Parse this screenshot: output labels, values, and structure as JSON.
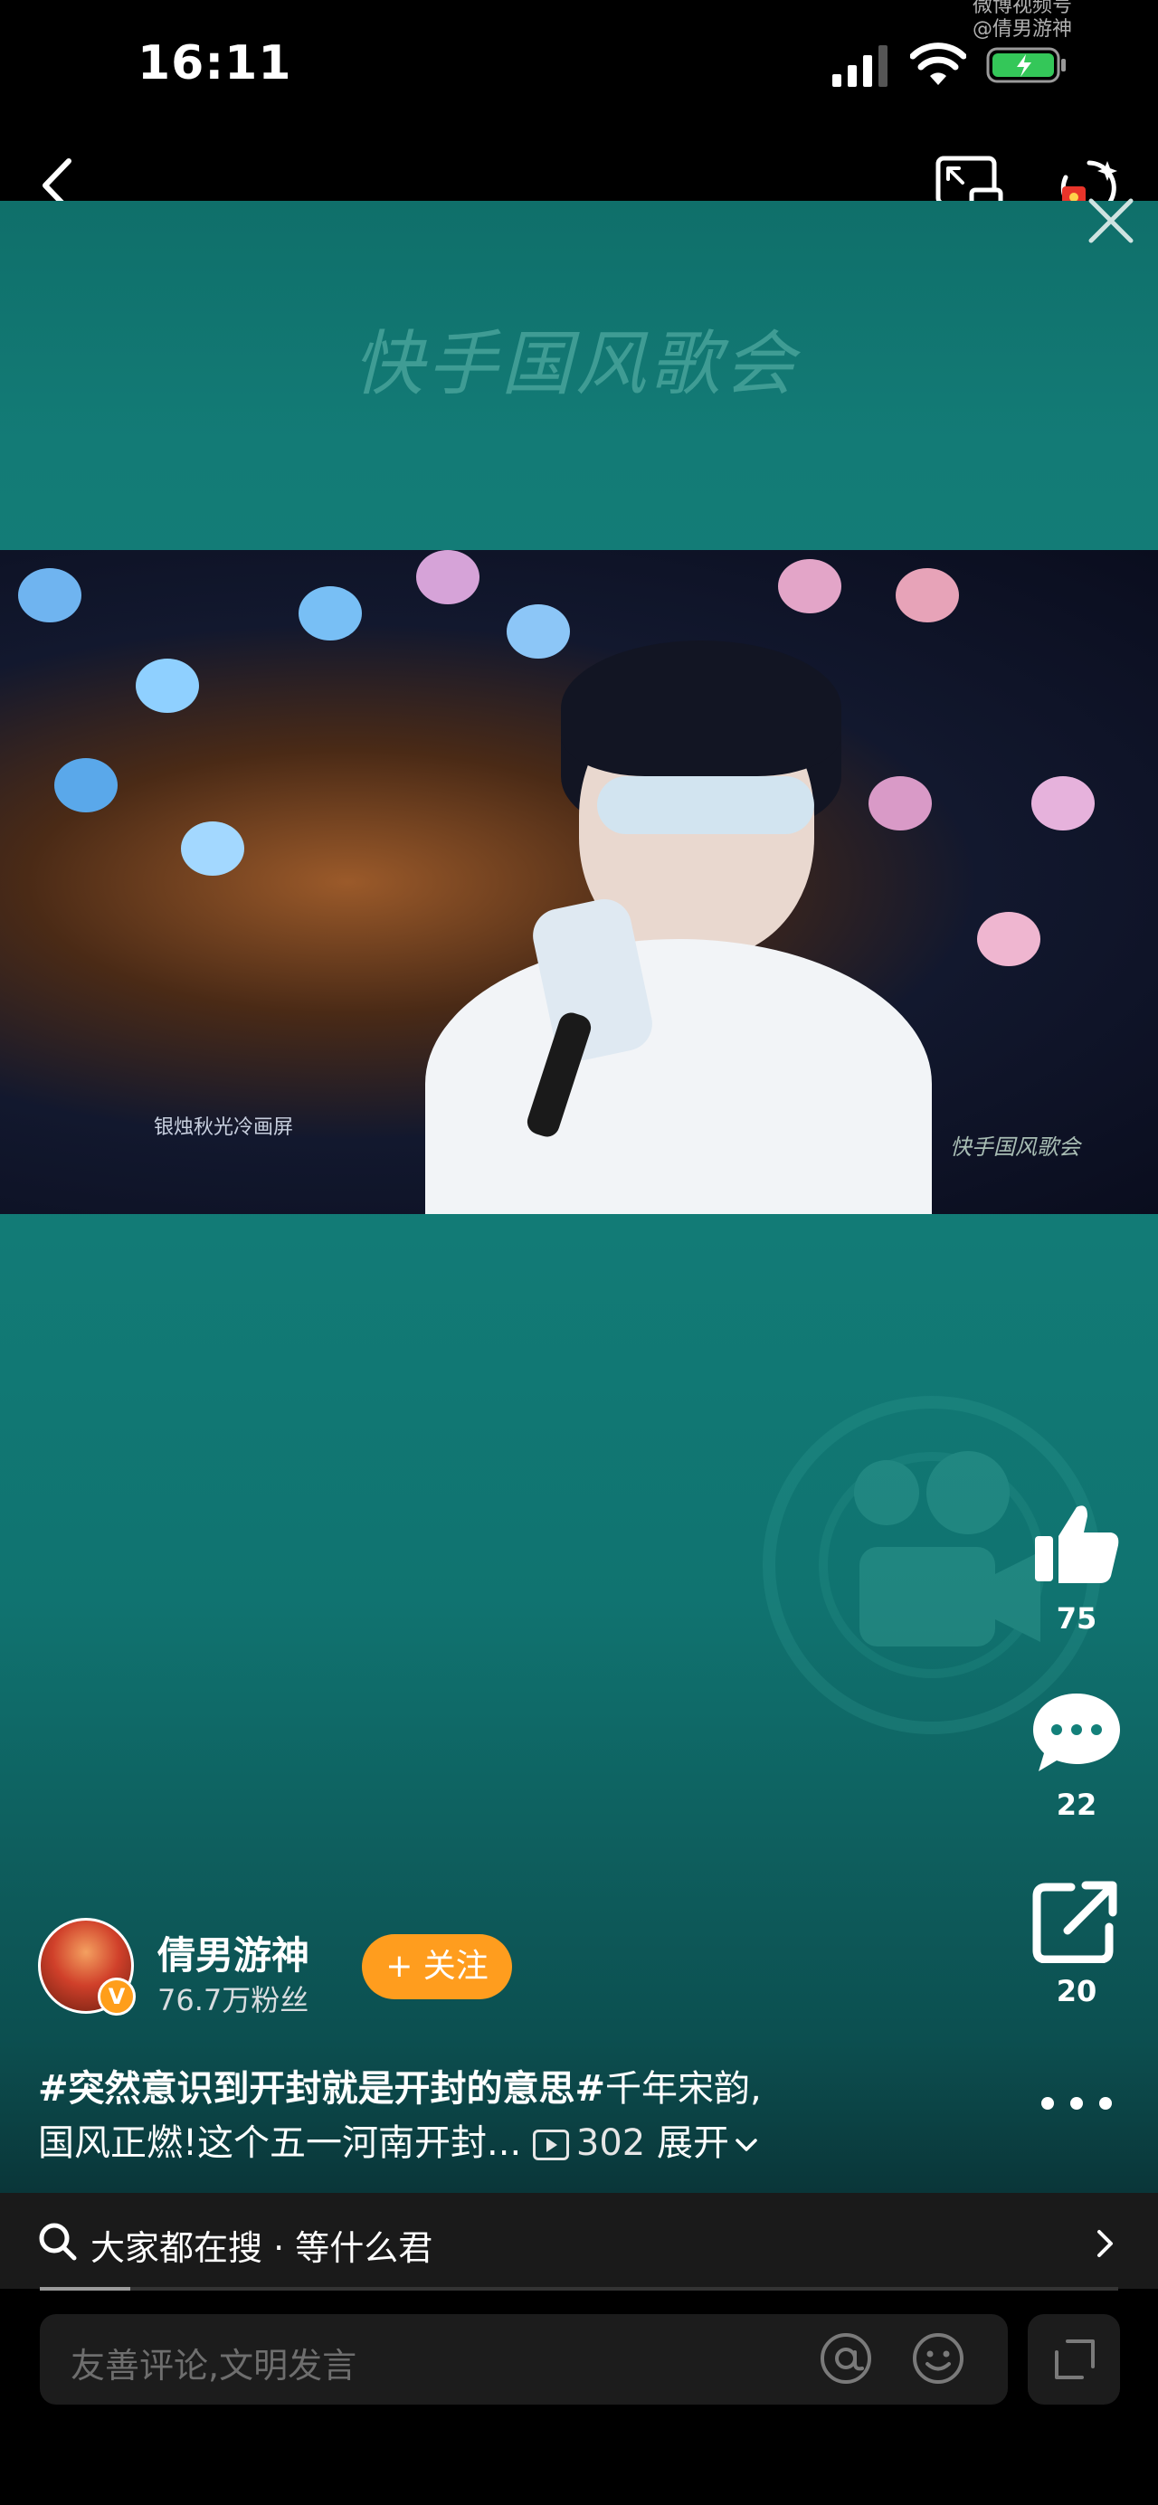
{
  "status_bar": {
    "time": "16:11",
    "watermark_line1": "微博视频号",
    "watermark_line2": "@倩男游神"
  },
  "video": {
    "banner_title": "快手国风歌会",
    "caption_left": "银烛秋光冷画屏",
    "caption_right": "快手国风歌会"
  },
  "actions": {
    "like_count": "75",
    "comment_count": "22",
    "share_count": "20"
  },
  "author": {
    "name": "倩男游神",
    "followers": "76.7万粉丝",
    "follow_label": "+ 关注",
    "verified_mark": "V"
  },
  "description": {
    "hashtag": "#突然意识到开封就是开封的意思#",
    "line1_rest": "千年宋韵,",
    "line2": "国风正燃!这个五一河南开封...",
    "views": "302",
    "expand_label": "展开"
  },
  "search": {
    "text": "大家都在搜 · 等什么君"
  },
  "comment_input": {
    "placeholder": "友善评论,文明发言"
  },
  "colors": {
    "accent": "#ff9d1e",
    "video_bg": "#13807a"
  },
  "icons": [
    "back-icon",
    "pip-icon",
    "red-packet-icon",
    "close-icon",
    "like-icon",
    "comment-icon",
    "share-icon",
    "more-icon",
    "search-icon",
    "chevron-right-icon",
    "at-icon",
    "emoji-icon",
    "expand-icon"
  ]
}
